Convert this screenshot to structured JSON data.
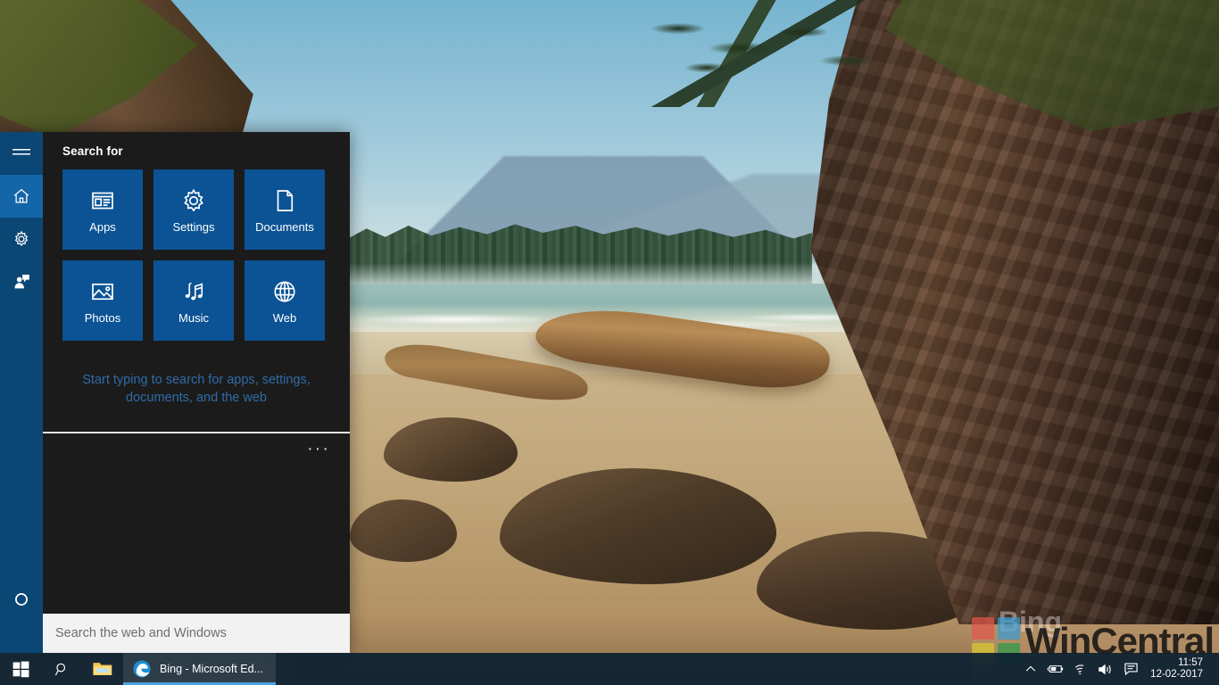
{
  "desktop": {
    "wallpaper_name": "beach-sea-stack-wallpaper"
  },
  "search_panel": {
    "header": "Search for",
    "hint": "Start typing to search for apps, settings, documents, and the web",
    "more_button": "···",
    "accent_tile_color": "#0b5394",
    "panel_bg_color": "#1b1b1b",
    "rail_bg_color": "#0b4774",
    "rail_active_color": "#1566a8",
    "hint_color": "#2f6ca8",
    "rail": [
      {
        "name": "hamburger-menu",
        "label": "Menu",
        "active": false
      },
      {
        "name": "home",
        "label": "Home",
        "active": true
      },
      {
        "name": "settings",
        "label": "Settings",
        "active": false
      },
      {
        "name": "feedback",
        "label": "Feedback",
        "active": false
      },
      {
        "name": "cortana",
        "label": "Cortana",
        "active": false
      }
    ],
    "tiles": [
      {
        "label": "Apps",
        "icon": "apps-icon"
      },
      {
        "label": "Settings",
        "icon": "settings-gear-icon"
      },
      {
        "label": "Documents",
        "icon": "document-icon"
      },
      {
        "label": "Photos",
        "icon": "photo-icon"
      },
      {
        "label": "Music",
        "icon": "music-note-icon"
      },
      {
        "label": "Web",
        "icon": "globe-icon"
      }
    ]
  },
  "search_box": {
    "value": "",
    "placeholder": "Search the web and Windows"
  },
  "taskbar": {
    "start_label": "Start",
    "search_label": "Search",
    "explorer_label": "File Explorer",
    "edge_window_title": "Bing - Microsoft Ed...",
    "tray": [
      {
        "name": "show-hidden-icons",
        "glyph": "chevron-up"
      },
      {
        "name": "battery-icon",
        "glyph": "battery"
      },
      {
        "name": "wifi-icon",
        "glyph": "wifi"
      },
      {
        "name": "volume-icon",
        "glyph": "volume"
      },
      {
        "name": "action-center-icon",
        "glyph": "action-center"
      }
    ],
    "clock": {
      "time": "11:57",
      "date": "12-02-2017"
    }
  },
  "watermark": {
    "brand": "WinCentral",
    "secondary": "Bing",
    "logo_colors": [
      "#e0564a",
      "#3b9bd1",
      "#d8c92e",
      "#2c9a4a"
    ]
  }
}
